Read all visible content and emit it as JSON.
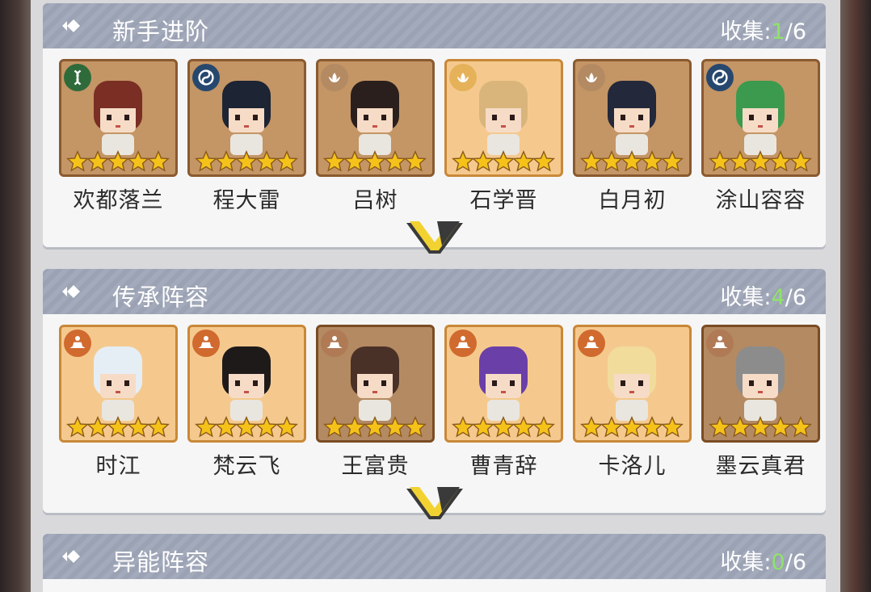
{
  "sections": [
    {
      "title": "新手进阶",
      "collect_label": "收集:",
      "collected": "1",
      "total": "/6",
      "heroes": [
        {
          "name": "欢都落兰",
          "badge": "dna-icon",
          "badge_color": "#2f6b3a",
          "hair": "#7a2e24",
          "stars": 5,
          "card": "normal"
        },
        {
          "name": "程大雷",
          "badge": "taiji-icon",
          "badge_color": "#27486e",
          "hair": "#1d2433",
          "stars": 5,
          "card": "normal"
        },
        {
          "name": "吕树",
          "badge": "lotus-icon",
          "badge_color": "#b38a62",
          "hair": "#2a1f1c",
          "stars": 5,
          "card": "normal"
        },
        {
          "name": "石学晋",
          "badge": "lotus-icon",
          "badge_color": "#e5b25a",
          "hair": "#d9b57c",
          "stars": 5,
          "card": "gold"
        },
        {
          "name": "白月初",
          "badge": "lotus-icon",
          "badge_color": "#b38a62",
          "hair": "#23283a",
          "stars": 5,
          "card": "normal"
        },
        {
          "name": "涂山容容",
          "badge": "taiji-icon",
          "badge_color": "#27486e",
          "hair": "#3c9a4e",
          "stars": 5,
          "card": "normal"
        }
      ]
    },
    {
      "title": "传承阵容",
      "collect_label": "收集:",
      "collected": "4",
      "total": "/6",
      "heroes": [
        {
          "name": "时江",
          "badge": "meditate-icon",
          "badge_color": "#d06a2e",
          "hair": "#e6eef5",
          "stars": 5,
          "card": "gold"
        },
        {
          "name": "梵云飞",
          "badge": "meditate-icon",
          "badge_color": "#d06a2e",
          "hair": "#1f1a1a",
          "stars": 5,
          "card": "gold"
        },
        {
          "name": "王富贵",
          "badge": "meditate-icon",
          "badge_color": "#b07a55",
          "hair": "#4a3128",
          "stars": 5,
          "card": "dark"
        },
        {
          "name": "曹青辞",
          "badge": "meditate-icon",
          "badge_color": "#d06a2e",
          "hair": "#6b3fa8",
          "stars": 5,
          "card": "gold"
        },
        {
          "name": "卡洛儿",
          "badge": "meditate-icon",
          "badge_color": "#d06a2e",
          "hair": "#f1dc9c",
          "stars": 5,
          "card": "gold"
        },
        {
          "name": "墨云真君",
          "badge": "meditate-icon",
          "badge_color": "#b07a55",
          "hair": "#8c8c8c",
          "stars": 5,
          "card": "dark"
        }
      ]
    },
    {
      "title": "异能阵容",
      "collect_label": "收集:",
      "collected": "0",
      "total": "/6",
      "heroes": []
    }
  ],
  "colors": {
    "header_bg": "#9ba2b3",
    "collected_green": "#8fe36a",
    "star_gold": "#f5c21a",
    "expand_yellow": "#f2d230"
  }
}
